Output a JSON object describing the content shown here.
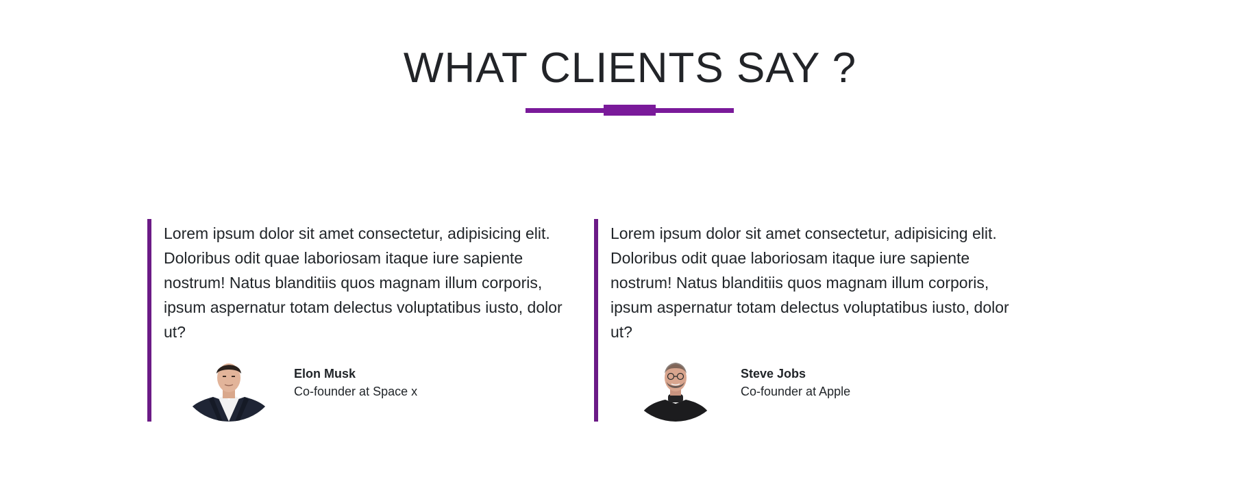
{
  "section": {
    "title": "WHAT CLIENTS SAY ?"
  },
  "accent_color": "#7a1a9a",
  "testimonials": [
    {
      "quote": "Lorem ipsum dolor sit amet consectetur, adipisicing elit. Doloribus odit quae laboriosam itaque iure sapiente nostrum! Natus blanditiis quos magnam illum corporis, ipsum aspernatur totam delectus voluptatibus iusto, dolor ut?",
      "name": "Elon Musk",
      "role": "Co-founder at Space x",
      "photo_icon": "person-photo"
    },
    {
      "quote": "Lorem ipsum dolor sit amet consectetur, adipisicing elit. Doloribus odit quae laboriosam itaque iure sapiente nostrum! Natus blanditiis quos magnam illum corporis, ipsum aspernatur totam delectus voluptatibus iusto, dolor ut?",
      "name": "Steve Jobs",
      "role": "Co-founder at Apple",
      "photo_icon": "person-photo"
    }
  ]
}
